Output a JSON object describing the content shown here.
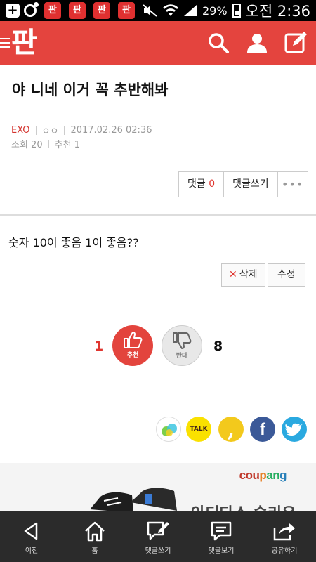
{
  "status_bar": {
    "battery": "29%",
    "time": "오전 2:36",
    "app_badge": "판"
  },
  "header": {
    "logo": "판"
  },
  "post": {
    "title": "야 니네 이거 꼭 추반해봐",
    "category": "EXO",
    "author": "ㅇㅇ",
    "datetime": "2017.02.26 02:36",
    "views_label": "조회 20",
    "recommend_label": "추천 1",
    "comment_label": "댓글",
    "comment_count": "0",
    "write_comment_label": "댓글쓰기",
    "more_label": "•••",
    "body": "숫자 10이 좋음 1이 좋음??",
    "delete_label": "삭제",
    "edit_label": "수정"
  },
  "votes": {
    "up_count": "1",
    "up_label": "추천",
    "down_count": "8",
    "down_label": "반대"
  },
  "share": {
    "kakaotalk_label": "TALK"
  },
  "ad": {
    "brand": [
      "cou",
      "p",
      "an",
      "g"
    ],
    "text": "아디다스 슬리우"
  },
  "nav": [
    {
      "label": "이전"
    },
    {
      "label": "홈"
    },
    {
      "label": "댓글쓰기"
    },
    {
      "label": "댓글보기"
    },
    {
      "label": "공유하기"
    }
  ],
  "colors": {
    "brand": "#e4443e",
    "accent_red": "#e0352f",
    "nav_bg": "#2b2b2b"
  }
}
